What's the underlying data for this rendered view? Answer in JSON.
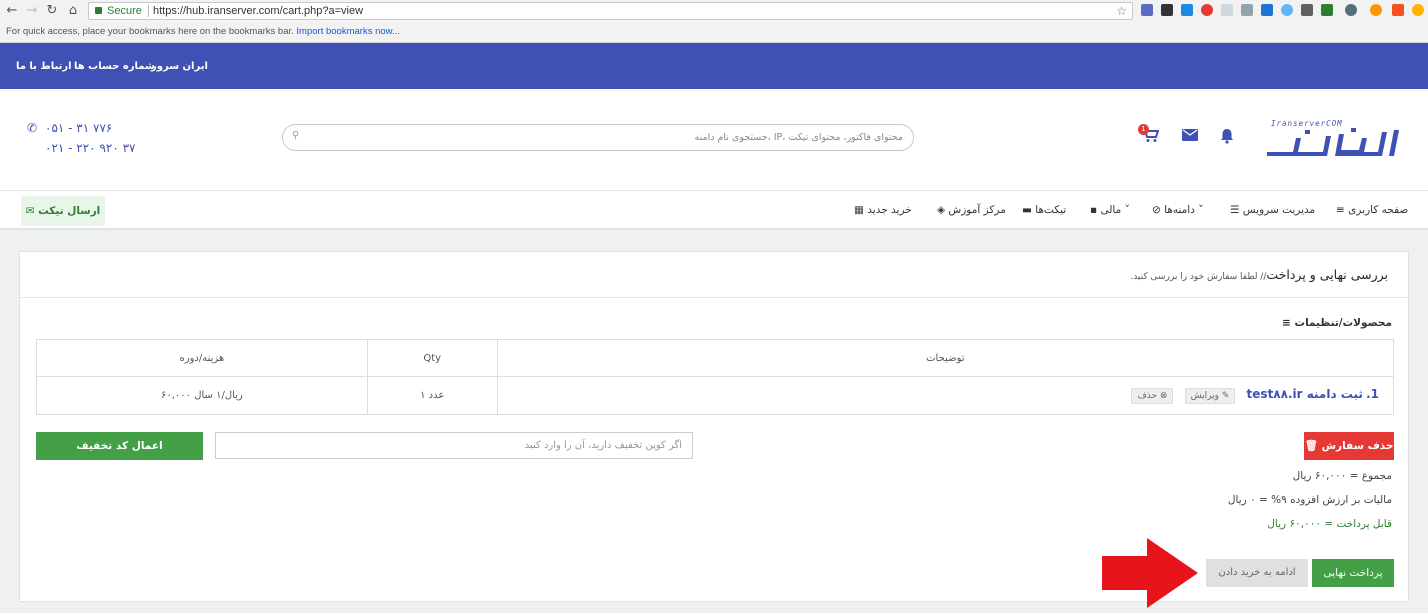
{
  "browser": {
    "security_label": "Secure",
    "url": "https://hub.iranserver.com/cart.php?a=view",
    "bookmarks_text": "For quick access, place your bookmarks here on the bookmarks bar.",
    "bookmarks_link": "Import bookmarks now..."
  },
  "topbar": {
    "links": [
      "ایران سرور",
      "شماره حساب ها",
      "ارتباط با ما"
    ]
  },
  "header": {
    "phone1": "۰۵۱ - ۳۱ ۷۷۶",
    "phone2": "۰۲۱ - ۲۲۰ ۹۲۰ ۳۷",
    "search_placeholder": "جستجوی نام دامنه، IP، محتوای فاکتور، محتوای تیکت",
    "cart_badge": "1",
    "logo_icon": "iranserver-logo"
  },
  "menu": {
    "items": [
      "صفحه کاربری",
      "مدیریت سرویس",
      "دامنه‌ها",
      "مالی",
      "تیکت‌ها",
      "مرکز آموزش",
      "خرید جدید"
    ],
    "send_ticket": "ارسال تیکت"
  },
  "order": {
    "title": "بررسی نهایی و پرداخت",
    "subtitle": "// لطفا سفارش خود را بررسی کنید.",
    "section_label": "محصولات/تنظیمات",
    "columns": [
      "توضیحات",
      "Qty",
      "هزینه/دوره"
    ],
    "row": {
      "index": "1.",
      "product": "ثبت دامنه test۸۸.ir",
      "edit": "ویرایش",
      "remove": "حذف",
      "qty": "۱ عدد",
      "price": "۶۰,۰۰۰ ریال/۱ سال"
    },
    "delete_order": "حذف سفارش",
    "coupon_placeholder": "اگر کوپن تخفیف دارید، آن را وارد کنید",
    "apply_coupon": "اعمال کد تخفیف",
    "subtotal": "مجموع = ۶۰,۰۰۰ ریال",
    "tax": "مالیات بر ارزش افزوده ۹% = ۰ ریال",
    "total": "قابل پرداخت = ۶۰,۰۰۰ ریال",
    "pay_button": "پرداخت نهایی",
    "continue_button": "ادامه به خرید دادن"
  },
  "colors": {
    "brand": "#3f51b5",
    "green": "#43a047",
    "red": "#e53935",
    "arrow": "#e8141c"
  }
}
